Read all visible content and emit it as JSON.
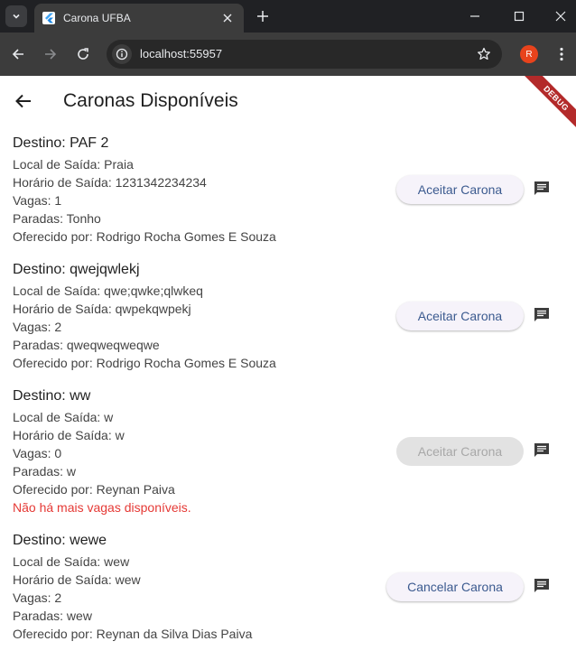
{
  "browser": {
    "tab_title": "Carona UFBA",
    "url": "localhost:55957",
    "profile_initial": "R"
  },
  "app": {
    "title": "Caronas Disponíveis",
    "debug_banner": "DEBUG",
    "colors": {
      "accent_text": "#3b5a8f",
      "warning": "#e53935",
      "debug_banner": "#b32a2a"
    }
  },
  "rides": [
    {
      "destination": "Destino: PAF 2",
      "departure_place": "Local de Saída: Praia",
      "departure_time": "Horário de Saída: 1231342234234",
      "seats": "Vagas: 1",
      "stops": "Paradas: Tonho",
      "offered_by": "Oferecido por: Rodrigo Rocha Gomes E Souza",
      "warning": "",
      "button_label": "Aceitar Carona",
      "button_enabled": true
    },
    {
      "destination": "Destino: qwejqwlekj",
      "departure_place": "Local de Saída: qwe;qwke;qlwkeq",
      "departure_time": "Horário de Saída: qwpekqwpekj",
      "seats": "Vagas: 2",
      "stops": "Paradas: qweqweqweqwe",
      "offered_by": "Oferecido por: Rodrigo Rocha Gomes E Souza",
      "warning": "",
      "button_label": "Aceitar Carona",
      "button_enabled": true
    },
    {
      "destination": "Destino: ww",
      "departure_place": "Local de Saída: w",
      "departure_time": "Horário de Saída: w",
      "seats": "Vagas: 0",
      "stops": "Paradas: w",
      "offered_by": "Oferecido por: Reynan Paiva",
      "warning": "Não há mais vagas disponíveis.",
      "button_label": "Aceitar Carona",
      "button_enabled": false
    },
    {
      "destination": "Destino: wewe",
      "departure_place": "Local de Saída: wew",
      "departure_time": "Horário de Saída: wew",
      "seats": "Vagas: 2",
      "stops": "Paradas: wew",
      "offered_by": "Oferecido por: Reynan da Silva Dias Paiva",
      "warning": "",
      "button_label": "Cancelar Carona",
      "button_enabled": true
    }
  ]
}
